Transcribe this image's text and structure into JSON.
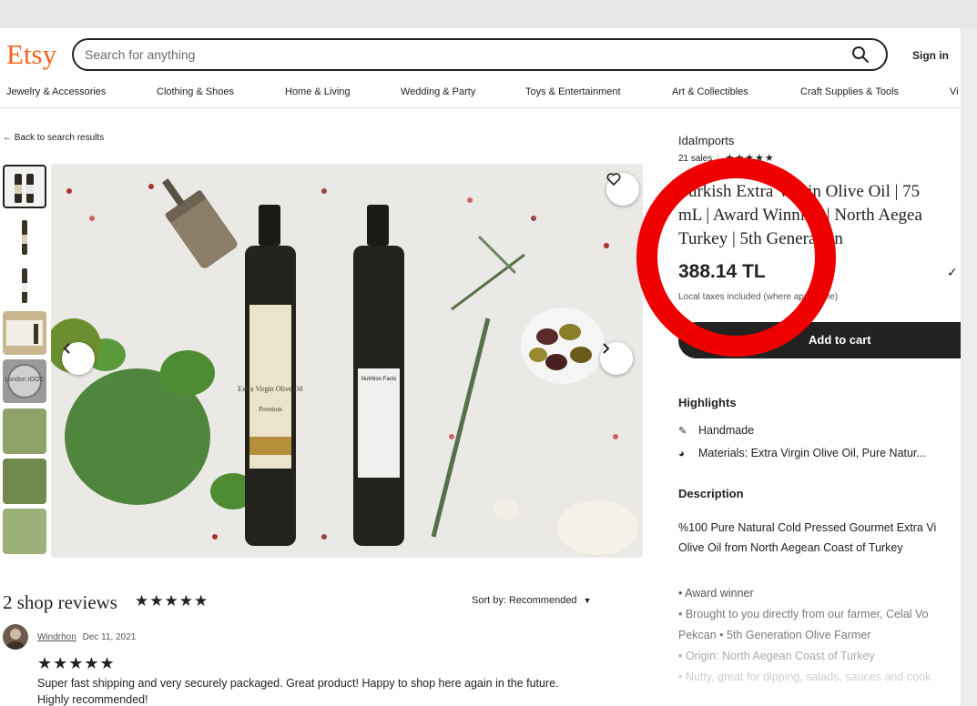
{
  "header": {
    "logo": "Etsy",
    "search_placeholder": "Search for anything",
    "sign_in": "Sign in"
  },
  "categories": [
    "Jewelry & Accessories",
    "Clothing & Shoes",
    "Home & Living",
    "Wedding & Party",
    "Toys & Entertainment",
    "Art & Collectibles",
    "Craft Supplies & Tools",
    "Vi"
  ],
  "back_link": "← Back to search results",
  "gallery": {
    "label_1": "Extra Virgin Olive Oil",
    "label_2": "Premium",
    "label_3": "Nutrition Facts",
    "award_text": "London IOOC"
  },
  "listing": {
    "shop_name": "IdaImports",
    "sales": "21 sales",
    "stars": "★★★★★",
    "title_line1": "Turkish Extra Virgin Olive Oil | 75",
    "title_line2": "mL | Award Winning | North Aegea",
    "title_line3": "Turkey | 5th Generation",
    "price": "388.14 TL",
    "taxes": "Local taxes included (where applicable)",
    "add_to_cart": "Add to cart",
    "check": "✓"
  },
  "highlights": {
    "heading": "Highlights",
    "handmade": "Handmade",
    "materials": "Materials: Extra Virgin Olive Oil, Pure Natur..."
  },
  "description": {
    "heading": "Description",
    "line1": "%100 Pure Natural Cold Pressed Gourmet Extra Vi",
    "line2": "Olive Oil from North Aegean Coast of Turkey",
    "bullet1": "• Award winner",
    "bullet2": "• Brought to you directly from our farmer, Celal Vo",
    "bullet3": "Pekcan • 5th Generation Olive Farmer",
    "bullet4": "• Origin: North Aegean Coast of Turkey",
    "bullet5": "• Nutty, great for dipping, salads, sauces and cook"
  },
  "reviews": {
    "title": "2 shop reviews",
    "stars": "★★★★★",
    "sort": "Sort by: Recommended",
    "reviewer": "Windrhon",
    "date": "Dec 11, 2021",
    "review_stars": "★★★★★",
    "text": "Super fast shipping and very securely packaged. Great product! Happy to shop here again in the future. Highly recommended!"
  },
  "colors": {
    "brand": "#f1641e",
    "annotation_ring": "#ee0000",
    "button": "#222222"
  }
}
